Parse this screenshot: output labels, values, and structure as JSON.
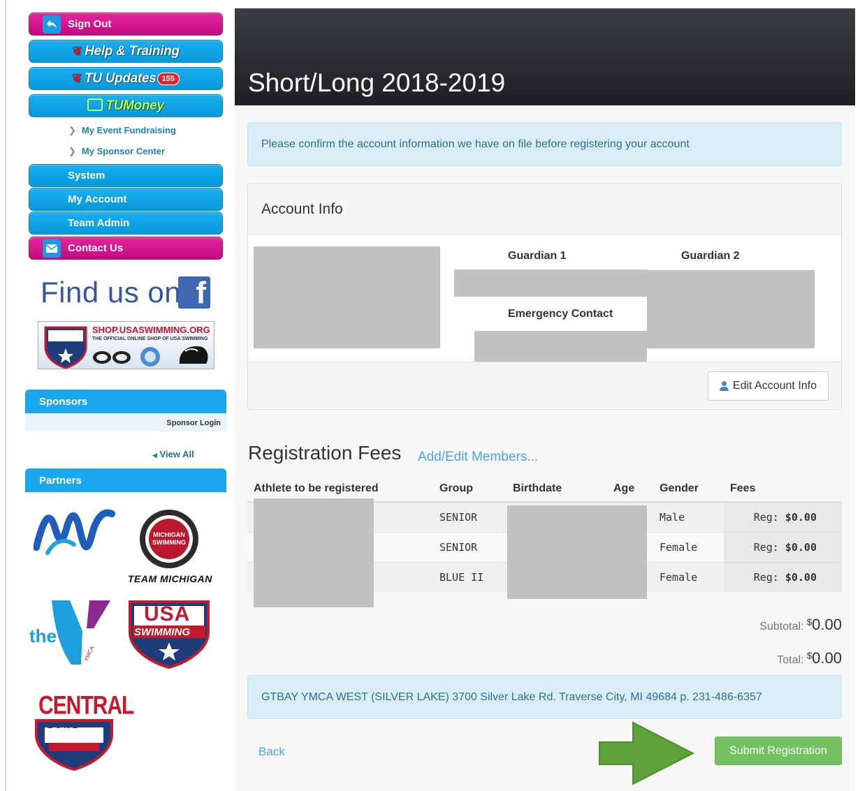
{
  "sidebar": {
    "sign_out": "Sign Out",
    "help_training": "Help & Training",
    "tu_updates": "TU Updates",
    "tu_updates_count": "155",
    "tu_money": "TUMoney",
    "event_fundraising": "My Event Fundraising",
    "sponsor_center": "My Sponsor Center",
    "system": "System",
    "my_account": "My Account",
    "team_admin": "Team Admin",
    "contact_us": "Contact Us",
    "find_us_on": "Find us on",
    "facebook_glyph": "f",
    "shop_url": "SHOP.USASWIMMING.ORG",
    "shop_tagline": "THE OFFICIAL ONLINE SHOP OF USA SWIMMING",
    "sponsors_header": "Sponsors",
    "sponsor_login": "Sponsor Login",
    "view_all": "View All",
    "partners_header": "Partners",
    "partner_team_michigan": "TEAM MICHIGAN",
    "partner_michigan_badge": "MICHIGAN SWIMMING",
    "partner_ymca": "the",
    "partner_ymca_small": "YMCA",
    "partner_usa": "USA",
    "partner_swimming": "SWIMMING",
    "partner_central": "CENTRAL",
    "partner_zone": "Z O N E"
  },
  "header": {
    "title": "Short/Long 2018-2019"
  },
  "notice": "Please confirm the account information we have on file before registering your account",
  "account_panel": {
    "title": "Account Info",
    "guardian1_label": "Guardian 1",
    "guardian2_label": "Guardian 2",
    "emergency_label": "Emergency Contact",
    "edit_button": "Edit Account Info"
  },
  "registration": {
    "title": "Registration Fees",
    "add_edit_link": "Add/Edit Members...",
    "columns": [
      "Athlete to be registered",
      "Group",
      "Birthdate",
      "Age",
      "Gender",
      "Fees"
    ],
    "rows": [
      {
        "group": "SENIOR",
        "gender": "Male",
        "fee_label": "Reg:",
        "fee": "$0.00"
      },
      {
        "group": "SENIOR",
        "gender": "Female",
        "fee_label": "Reg:",
        "fee": "$0.00"
      },
      {
        "group": "BLUE II",
        "gender": "Female",
        "fee_label": "Reg:",
        "fee": "$0.00"
      }
    ],
    "subtotal_label": "Subtotal:",
    "subtotal_currency": "$",
    "subtotal_value": "0.00",
    "total_label": "Total:",
    "total_currency": "$",
    "total_value": "0.00"
  },
  "club_info": "GTBAY YMCA WEST (SILVER LAKE) 3700 Silver Lake Rd. Traverse City, MI 49684 p. 231-486-6357",
  "actions": {
    "back": "Back",
    "submit": "Submit Registration"
  },
  "colors": {
    "magenta": "#d0178a",
    "sidebar_blue": "#1aa7ee",
    "submit_green": "#74c162",
    "link_blue": "#4da6e8",
    "alert_bg": "#d9edf7"
  }
}
